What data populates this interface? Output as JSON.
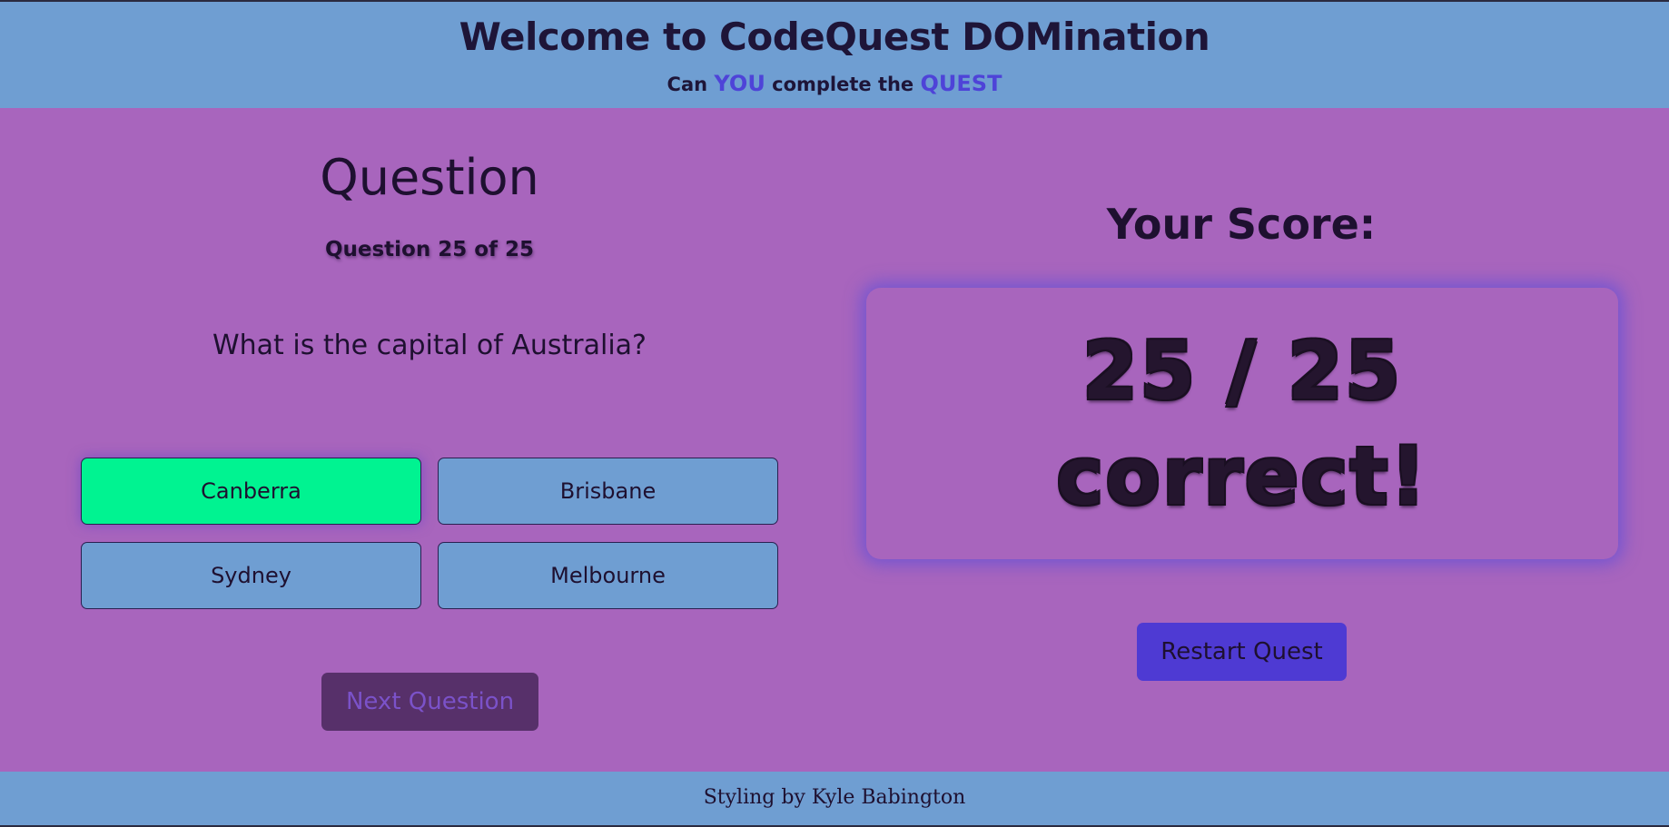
{
  "header": {
    "title": "Welcome to CodeQuest DOMination",
    "tagline_part1": "Can ",
    "tagline_accent1": "YOU",
    "tagline_part2": " complete the ",
    "tagline_accent2": "QUEST"
  },
  "question_panel": {
    "heading": "Question",
    "counter": "Question 25 of 25",
    "question_text": "What is the capital of Australia?",
    "answers": [
      {
        "label": "Canberra",
        "state": "correct"
      },
      {
        "label": "Brisbane",
        "state": "default"
      },
      {
        "label": "Sydney",
        "state": "default"
      },
      {
        "label": "Melbourne",
        "state": "default"
      }
    ],
    "next_label": "Next Question"
  },
  "score_panel": {
    "heading": "Your Score:",
    "score_line": "25 / 25",
    "result_line": "correct!",
    "restart_label": "Restart Quest"
  },
  "footer": {
    "credit": "Styling by Kyle Babington"
  },
  "colors": {
    "page_bg": "#a865bd",
    "header_bg": "#6f9ed2",
    "accent": "#4e43d8",
    "correct_answer": "#00f391",
    "answer_default": "#6f9ed2",
    "next_disabled": "#57306a",
    "restart_bg": "#4e3ad3"
  }
}
